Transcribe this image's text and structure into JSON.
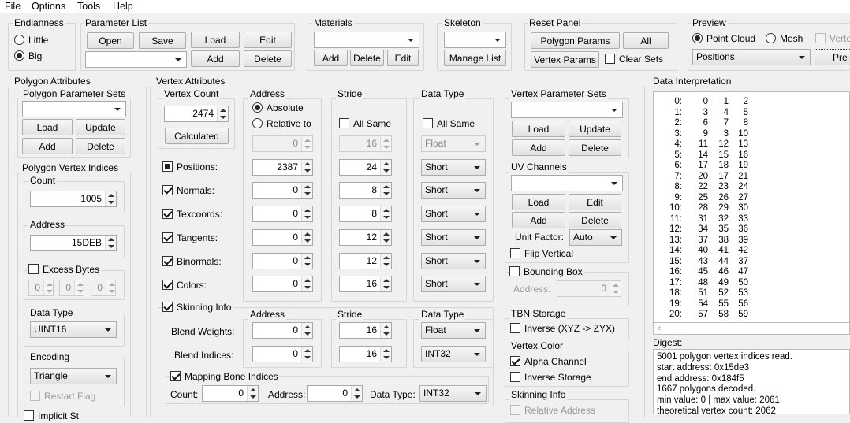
{
  "menu": [
    "File",
    "Options",
    "Tools",
    "Help"
  ],
  "endianness": {
    "title": "Endianness",
    "little": "Little",
    "big": "Big"
  },
  "param_list": {
    "title": "Parameter List",
    "open": "Open",
    "save": "Save",
    "load": "Load",
    "edit": "Edit",
    "add": "Add",
    "delete": "Delete"
  },
  "materials": {
    "title": "Materials",
    "add": "Add",
    "delete": "Delete",
    "edit": "Edit"
  },
  "skeleton": {
    "title": "Skeleton",
    "manage": "Manage List"
  },
  "reset": {
    "title": "Reset Panel",
    "polygon_params": "Polygon Params",
    "all": "All",
    "vertex_params": "Vertex Params",
    "clear_sets": "Clear Sets"
  },
  "preview": {
    "title": "Preview",
    "point_cloud": "Point Cloud",
    "mesh": "Mesh",
    "vertex": "Verte",
    "combo": "Positions",
    "button": "Pre"
  },
  "polygon_attributes": {
    "title": "Polygon Attributes",
    "param_sets_title": "Polygon Parameter Sets",
    "load": "Load",
    "update": "Update",
    "add": "Add",
    "delete": "Delete",
    "indices_title": "Polygon Vertex Indices",
    "count_label": "Count",
    "count": "1005",
    "address_label": "Address",
    "address": "15DEB",
    "excess": "Excess Bytes",
    "excess_vals": [
      "0",
      "0",
      "0"
    ],
    "data_type_label": "Data Type",
    "data_type": "UINT16",
    "encoding_label": "Encoding",
    "encoding": "Triangle",
    "restart": "Restart Flag",
    "implicit": "Implicit St"
  },
  "vertex_attributes": {
    "title": "Vertex Attributes",
    "count_title": "Vertex Count",
    "count": "2474",
    "calculated": "Calculated",
    "address_title": "Address",
    "absolute": "Absolute",
    "relative": "Relative to",
    "relative_val": "0",
    "stride_title": "Stride",
    "all_same": "All Same",
    "stride_all": "16",
    "dtype_title": "Data Type",
    "dtype_all": "Float",
    "rows": [
      {
        "label": "Positions:",
        "addr": "2387",
        "stride": "24",
        "type": "Short"
      },
      {
        "label": "Normals:",
        "addr": "0",
        "stride": "8",
        "type": "Short"
      },
      {
        "label": "Texcoords:",
        "addr": "0",
        "stride": "8",
        "type": "Short"
      },
      {
        "label": "Tangents:",
        "addr": "0",
        "stride": "12",
        "type": "Short"
      },
      {
        "label": "Binormals:",
        "addr": "0",
        "stride": "12",
        "type": "Short"
      },
      {
        "label": "Colors:",
        "addr": "0",
        "stride": "16",
        "type": "Short"
      }
    ],
    "skinning": "Skinning Info",
    "sk_address": "Address",
    "sk_stride": "Stride",
    "sk_dtype": "Data Type",
    "blend_weights": "Blend Weights:",
    "bw_addr": "0",
    "bw_stride": "16",
    "bw_type": "Float",
    "blend_indices": "Blend Indices:",
    "bi_addr": "0",
    "bi_stride": "16",
    "bi_type": "INT32",
    "mapping": "Mapping Bone Indices",
    "m_count_label": "Count:",
    "m_count": "0",
    "m_addr_label": "Address:",
    "m_addr": "0",
    "m_dtype_label": "Data Type:",
    "m_dtype": "INT32"
  },
  "vertex_param_sets": {
    "title": "Vertex Parameter Sets",
    "load": "Load",
    "update": "Update",
    "add": "Add",
    "delete": "Delete"
  },
  "uv": {
    "title": "UV Channels",
    "load": "Load",
    "edit": "Edit",
    "add": "Add",
    "delete": "Delete",
    "unit_factor_label": "Unit Factor:",
    "unit_factor": "Auto",
    "flip": "Flip Vertical"
  },
  "bbox": {
    "title": "Bounding Box",
    "address_label": "Address:",
    "address": "0"
  },
  "tbn": {
    "title": "TBN Storage",
    "inverse": "Inverse (XYZ -> ZYX)"
  },
  "vcolor": {
    "title": "Vertex Color",
    "alpha": "Alpha Channel",
    "inverse": "Inverse Storage"
  },
  "skinfo": {
    "title": "Skinning Info",
    "relative": "Relative Address"
  },
  "data_interp": {
    "title": "Data Interpretation",
    "rows": [
      [
        "0:",
        "0",
        "1",
        "2"
      ],
      [
        "1:",
        "3",
        "4",
        "5"
      ],
      [
        "2:",
        "6",
        "7",
        "8"
      ],
      [
        "3:",
        "9",
        "3",
        "10"
      ],
      [
        "4:",
        "11",
        "12",
        "13"
      ],
      [
        "5:",
        "14",
        "15",
        "16"
      ],
      [
        "6:",
        "17",
        "18",
        "19"
      ],
      [
        "7:",
        "20",
        "17",
        "21"
      ],
      [
        "8:",
        "22",
        "23",
        "24"
      ],
      [
        "9:",
        "25",
        "26",
        "27"
      ],
      [
        "10:",
        "28",
        "29",
        "30"
      ],
      [
        "11:",
        "31",
        "32",
        "33"
      ],
      [
        "12:",
        "34",
        "35",
        "36"
      ],
      [
        "13:",
        "37",
        "38",
        "39"
      ],
      [
        "14:",
        "40",
        "41",
        "42"
      ],
      [
        "15:",
        "43",
        "44",
        "37"
      ],
      [
        "16:",
        "45",
        "46",
        "47"
      ],
      [
        "17:",
        "48",
        "49",
        "50"
      ],
      [
        "18:",
        "51",
        "52",
        "53"
      ],
      [
        "19:",
        "54",
        "55",
        "56"
      ],
      [
        "20:",
        "57",
        "58",
        "59"
      ]
    ]
  },
  "digest": {
    "title": "Digest:",
    "lines": [
      "5001 polygon vertex indices read.",
      "start address: 0x15de3",
      "end address: 0x184f5",
      "1667 polygons decoded.",
      "min value: 0 | max value: 2061",
      "theoretical vertex count: 2062"
    ]
  }
}
